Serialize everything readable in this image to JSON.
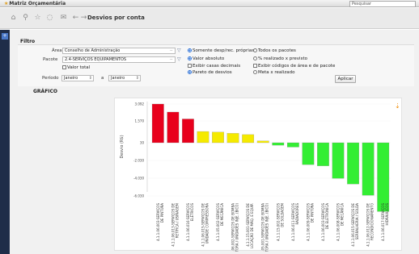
{
  "window": {
    "title": "Matriz Orçamentária",
    "search_placeholder": "Pesquisar"
  },
  "toolbar": {
    "page_title": "Desvios por conta"
  },
  "filter": {
    "header": "Filtro",
    "area_label": "Área",
    "area_value": "Conselho de Administração",
    "pacote_label": "Pacote",
    "pacote_value": "2.4-SERVIÇOS EQUIPAMENTOS",
    "valor_total_label": "Valor total",
    "periodo_label": "Período",
    "periodo_from": "Janeiro",
    "periodo_sep": "a",
    "periodo_to": "Janeiro",
    "options": {
      "somente": "Somente desp/rec. próprias",
      "todos": "Todos os pacotes",
      "valor_absoluto": "Valor absoluto",
      "percentual": "% realizado x previsto",
      "exibir_casas": "Exibir casas decimais",
      "exibir_codigos": "Exibir códigos de área e de pacote",
      "pareto": "Pareto de desvios",
      "meta": "Meta x realizado"
    },
    "apply_label": "Aplicar"
  },
  "grafico": {
    "header": "GRÁFICO"
  },
  "chart_data": {
    "type": "bar",
    "ylabel": "Desvio (R$)",
    "ylim": [
      -6030,
      3850
    ],
    "yticks": [
      3.092,
      1.57,
      30,
      -2.03,
      -4.03,
      -6.03
    ],
    "ytick_labels": [
      "3.092",
      "1.570",
      "30",
      "-2.030",
      "-4.030",
      "-6.030"
    ],
    "categories": [
      "4.1.1.06.003-SERVIÇOS DE PINTURA",
      "4.1.1.06.013-SERVIÇOS DE RETÍFICA / USINAGEM",
      "4.1.1.06.016-SERVIÇOS ELÉTRICOS",
      "4.1.1.06.015-SERVIÇOS DE UNIDADE COMPRESSORA",
      "4.1.1.05.002-SERVIÇOS DE MECÂNICA",
      "4.1.1.06.002-SERVIÇOS DE BOMBA INJETORA / UNIDADES INJE. (BICO)",
      "4.1.1.15.001-SERVIÇOS DE LOCAÇÃO DE MÁQ. E EQUIP.",
      "4.1.1.05.001-SERVIÇOS DE BOMBA INJETORA / UNIDADES INJE. (BICO)",
      "4.1.1.15.002-SERVIÇOS DE SOLDAGEM",
      "4.1.1.06.011-SERVIÇOS RADIADORES",
      "4.1.1.06.009-SERVIÇOS DE PINTURA",
      "4.1.1.06.003-SERVIÇOS DE ELETRÔNICA",
      "4.1.1.06.008-SERVIÇOS DE MECÂNICA",
      "4.1.1.06.015-SERVIÇOS DE SERRALHERIA / SOLDA",
      "4.1.1.06.012-SERVIÇOS DE RECONDICIONAMENTO",
      "4.1.1.06.017-SERVIÇOS HIDRÁULICOS"
    ],
    "values": [
      3092,
      2450,
      1900,
      900,
      850,
      750,
      650,
      150,
      -200,
      -350,
      -1750,
      -1850,
      -2850,
      -3300,
      -4200,
      -5500
    ],
    "colors": [
      "#e8001c",
      "#e8001c",
      "#e8001c",
      "#f5ea00",
      "#f5ea00",
      "#f5ea00",
      "#f5ea00",
      "#f5ea00",
      "#33ee33",
      "#33ee33",
      "#33ee33",
      "#33ee33",
      "#33ee33",
      "#33ee33",
      "#33ee33",
      "#33ee33"
    ]
  }
}
